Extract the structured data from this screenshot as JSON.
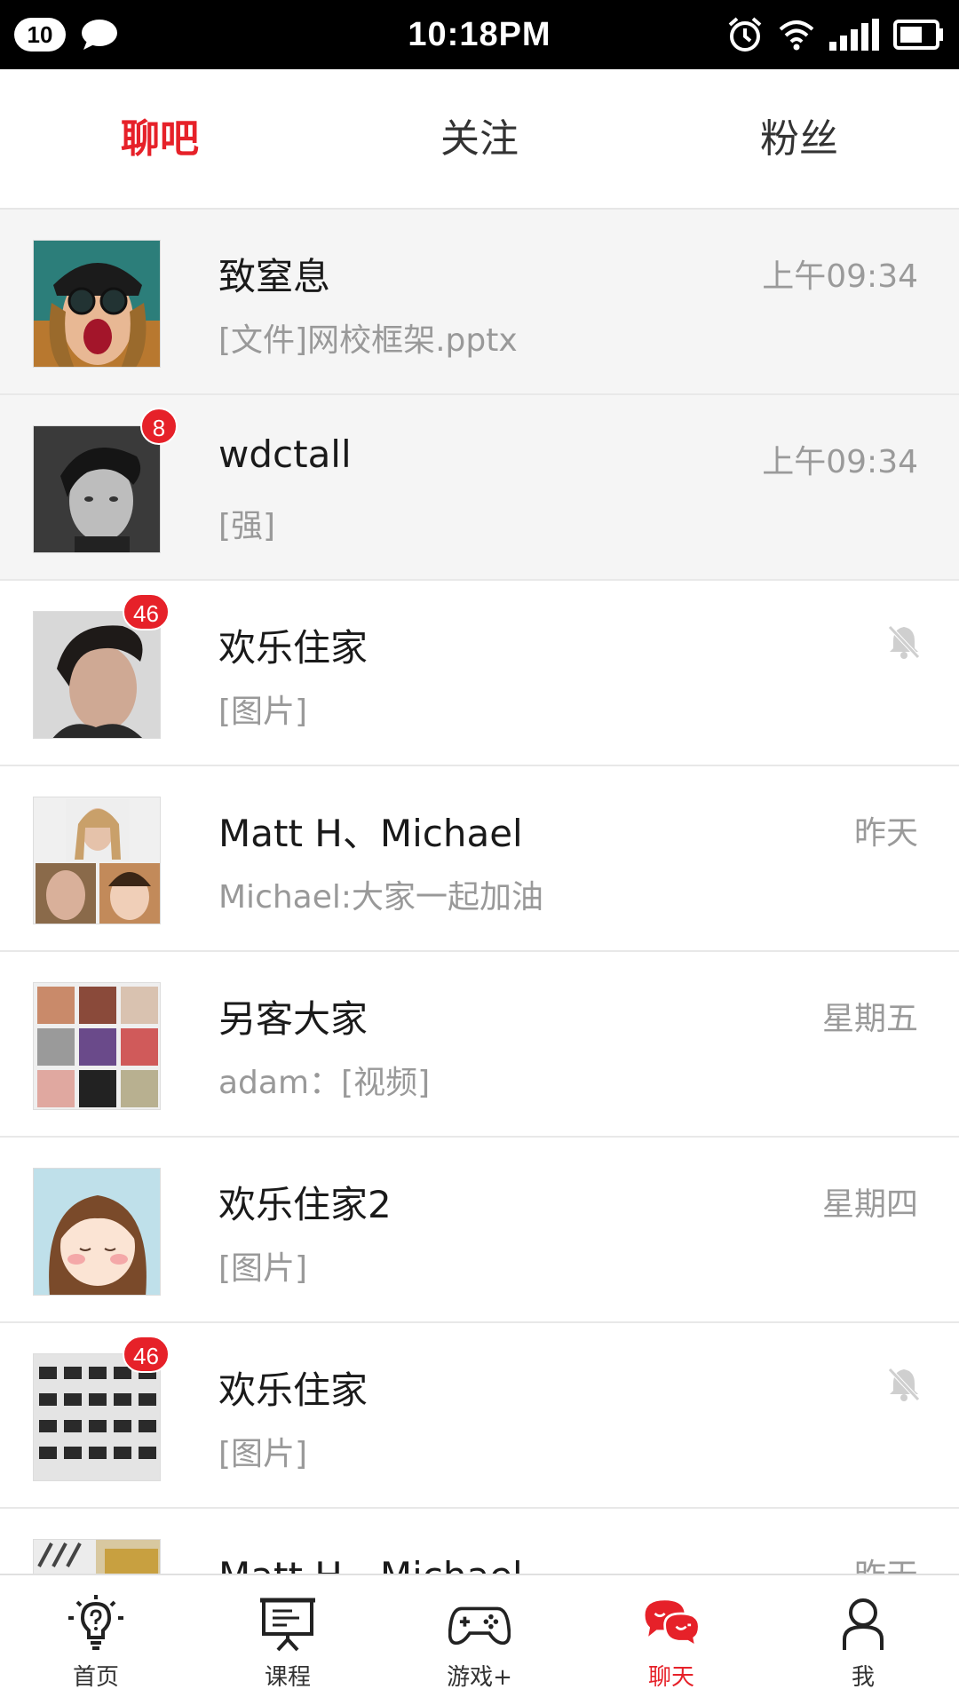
{
  "status_bar": {
    "notification_count": "10",
    "time": "10:18PM",
    "icons": [
      "chat-bubble-icon",
      "alarm-icon",
      "wifi-icon",
      "signal-icon",
      "battery-icon"
    ]
  },
  "top_tabs": [
    {
      "label": "聊吧",
      "active": true
    },
    {
      "label": "关注",
      "active": false
    },
    {
      "label": "粉丝",
      "active": false
    }
  ],
  "chats": [
    {
      "name": "致窒息",
      "preview": "[文件]网校框架.pptx",
      "time": "上午09:34",
      "unread": "",
      "muted": false,
      "pinned": true
    },
    {
      "name": "wdctall",
      "preview": "[强]",
      "time": "上午09:34",
      "unread": "8",
      "muted": false,
      "pinned": true
    },
    {
      "name": "欢乐住家",
      "preview": "[图片]",
      "time": "",
      "unread": "46",
      "muted": true,
      "pinned": false
    },
    {
      "name": "Matt H、Michael",
      "preview": "Michael:大家一起加油",
      "time": "昨天",
      "unread": "",
      "muted": false,
      "pinned": false
    },
    {
      "name": "另客大家",
      "preview": "adam：[视频]",
      "time": "星期五",
      "unread": "",
      "muted": false,
      "pinned": false
    },
    {
      "name": "欢乐住家2",
      "preview": "[图片]",
      "time": "星期四",
      "unread": "",
      "muted": false,
      "pinned": false
    },
    {
      "name": "欢乐住家",
      "preview": "[图片]",
      "time": "",
      "unread": "46",
      "muted": true,
      "pinned": false
    },
    {
      "name": "Matt H、Michael",
      "preview": "",
      "time": "昨天",
      "unread": "",
      "muted": false,
      "pinned": false
    }
  ],
  "bottom_nav": [
    {
      "label": "首页",
      "icon": "lightbulb-icon",
      "active": false
    },
    {
      "label": "课程",
      "icon": "presentation-board-icon",
      "active": false
    },
    {
      "label": "游戏+",
      "icon": "gamepad-icon",
      "active": false
    },
    {
      "label": "聊天",
      "icon": "chat-bubbles-icon",
      "active": true
    },
    {
      "label": "我",
      "icon": "user-icon",
      "active": false
    }
  ],
  "colors": {
    "accent": "#e62129",
    "pinned_bg": "#f5f5f5",
    "muted_text": "#999999"
  }
}
